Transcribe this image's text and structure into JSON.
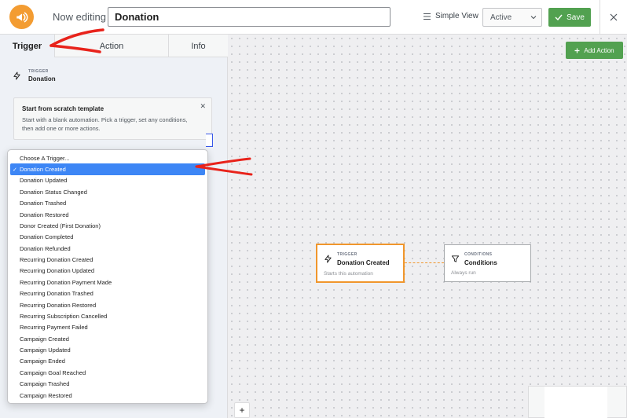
{
  "header": {
    "now_editing_label": "Now editing",
    "automation_name": "Donation",
    "simple_view_label": "Simple View",
    "status_value": "Active",
    "save_label": "Save"
  },
  "sidebar": {
    "tabs": [
      {
        "label": "Trigger",
        "active": true
      },
      {
        "label": "Action",
        "active": false
      },
      {
        "label": "Info",
        "active": false
      }
    ],
    "trigger_section": {
      "label": "TRIGGER",
      "value": "Donation"
    },
    "template_card": {
      "title": "Start from scratch template",
      "description": "Start with a blank automation. Pick a trigger, set any conditions, then add one or more actions."
    },
    "trigger_dropdown": {
      "selected": "Donation Created",
      "options": [
        "Choose A Trigger...",
        "Donation Created",
        "Donation Updated",
        "Donation Status Changed",
        "Donation Trashed",
        "Donation Restored",
        "Donor Created (First Donation)",
        "Donation Completed",
        "Donation Refunded",
        "Recurring Donation Created",
        "Recurring Donation Updated",
        "Recurring Donation Payment Made",
        "Recurring Donation Trashed",
        "Recurring Donation Restored",
        "Recurring Subscription Cancelled",
        "Recurring Payment Failed",
        "Campaign Created",
        "Campaign Updated",
        "Campaign Ended",
        "Campaign Goal Reached",
        "Campaign Trashed",
        "Campaign Restored"
      ]
    }
  },
  "canvas": {
    "add_action_label": "Add Action",
    "zoom_in_label": "+",
    "trigger_node": {
      "label": "TRIGGER",
      "title": "Donation Created",
      "subtitle": "Starts this automation"
    },
    "conditions_node": {
      "label": "CONDITIONS",
      "title": "Conditions",
      "subtitle": "Always run"
    }
  },
  "colors": {
    "brand_orange": "#f39c32",
    "save_green": "#52a150",
    "selected_blue": "#3d86f5",
    "trigger_border": "#f0962c",
    "annotation_red": "#e8231b"
  },
  "icons": [
    "megaphone-icon",
    "menu-lines-icon",
    "chevron-down-icon",
    "check-icon",
    "close-icon",
    "bolt-icon",
    "funnel-icon",
    "plus-icon"
  ]
}
